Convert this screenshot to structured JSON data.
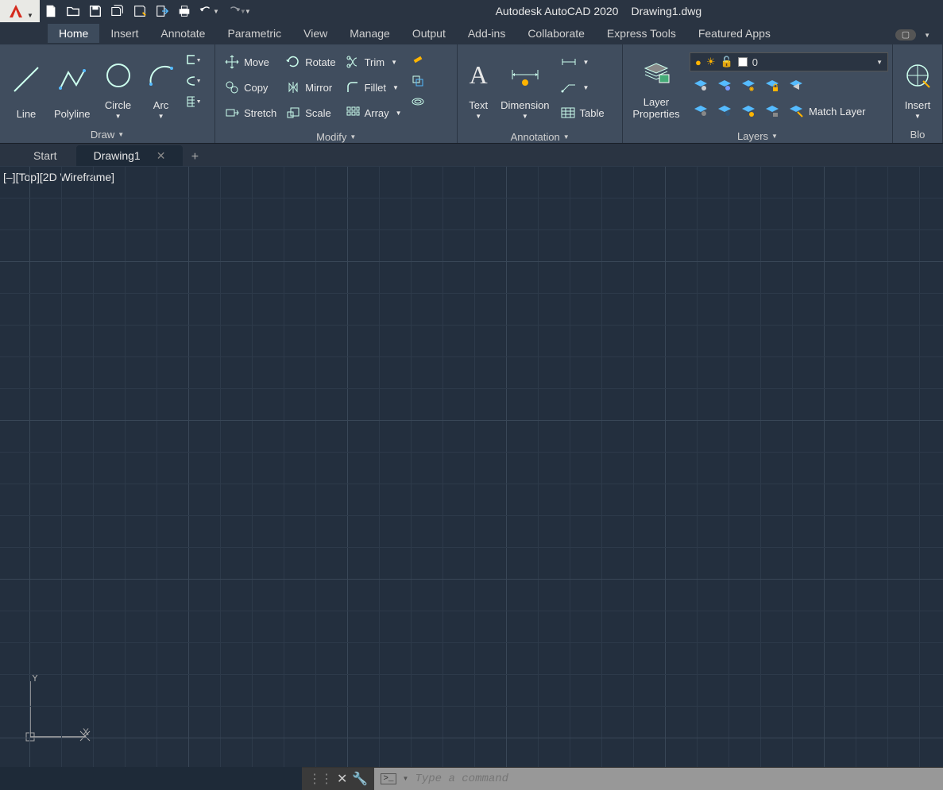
{
  "title": {
    "app": "Autodesk AutoCAD 2020",
    "file": "Drawing1.dwg"
  },
  "menubar": {
    "items": [
      "Home",
      "Insert",
      "Annotate",
      "Parametric",
      "View",
      "Manage",
      "Output",
      "Add-ins",
      "Collaborate",
      "Express Tools",
      "Featured Apps"
    ],
    "active": "Home"
  },
  "ribbon": {
    "draw": {
      "title": "Draw",
      "line": "Line",
      "polyline": "Polyline",
      "circle": "Circle",
      "arc": "Arc"
    },
    "modify": {
      "title": "Modify",
      "move": "Move",
      "rotate": "Rotate",
      "trim": "Trim",
      "copy": "Copy",
      "mirror": "Mirror",
      "fillet": "Fillet",
      "stretch": "Stretch",
      "scale": "Scale",
      "array": "Array"
    },
    "annotation": {
      "title": "Annotation",
      "text": "Text",
      "dimension": "Dimension",
      "table": "Table"
    },
    "layers": {
      "title": "Layers",
      "layer_properties": "Layer\nProperties",
      "current": "0",
      "match": "Match Layer"
    },
    "block": {
      "title": "Blo",
      "insert": "Insert"
    }
  },
  "doc_tabs": {
    "start": "Start",
    "drawing": "Drawing1"
  },
  "viewport": {
    "label": "[–][Top][2D Wireframe]",
    "ucs_y": "Y",
    "ucs_x": "X"
  },
  "command": {
    "placeholder": "Type a command"
  }
}
